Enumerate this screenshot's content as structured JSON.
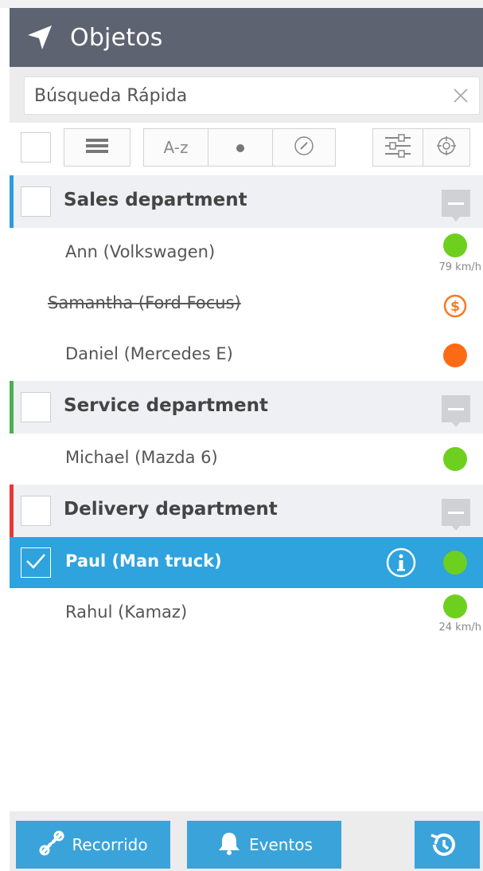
{
  "header": {
    "title": "Objetos",
    "icon": "navigation-arrow-icon"
  },
  "search": {
    "placeholder": "Búsqueda Rápida",
    "value": ""
  },
  "toolbar": {
    "sort_az_label": "A-z",
    "buttons": [
      "list-view-icon",
      "sort-az",
      "status-dot-icon",
      "speedometer-icon",
      "filter-settings-icon",
      "crosshair-icon"
    ]
  },
  "groups": [
    {
      "name": "Sales department",
      "color": "#2e9be3",
      "items": [
        {
          "label": "Ann (Volkswagen)",
          "status": "online",
          "status_color": "#6ed01e",
          "speed": "79 km/h",
          "strikethrough": false
        },
        {
          "label": "Samantha (Ford Focus)",
          "status": "billing",
          "status_color": "#f97a1f",
          "speed": "",
          "strikethrough": true
        },
        {
          "label": "Daniel (Mercedes E)",
          "status": "stopped",
          "status_color": "#fb6b16",
          "speed": "",
          "strikethrough": false
        }
      ]
    },
    {
      "name": "Service department",
      "color": "#4caf50",
      "items": [
        {
          "label": "Michael (Mazda 6)",
          "status": "online",
          "status_color": "#6ed01e",
          "speed": "",
          "strikethrough": false
        }
      ]
    },
    {
      "name": "Delivery department",
      "color": "#e53935",
      "items": [
        {
          "label": "Paul (Man truck)",
          "status": "online",
          "status_color": "#6ed01e",
          "speed": "",
          "selected": true,
          "strikethrough": false
        },
        {
          "label": "Rahul (Kamaz)",
          "status": "online",
          "status_color": "#6ed01e",
          "speed": "24 km/h",
          "strikethrough": false
        }
      ]
    }
  ],
  "footer": {
    "route_label": "Recorrido",
    "events_label": "Eventos",
    "history_icon": "history-icon"
  },
  "colors": {
    "header_bg": "#5d6371",
    "accent": "#2ea3de",
    "button": "#3aa3da"
  }
}
